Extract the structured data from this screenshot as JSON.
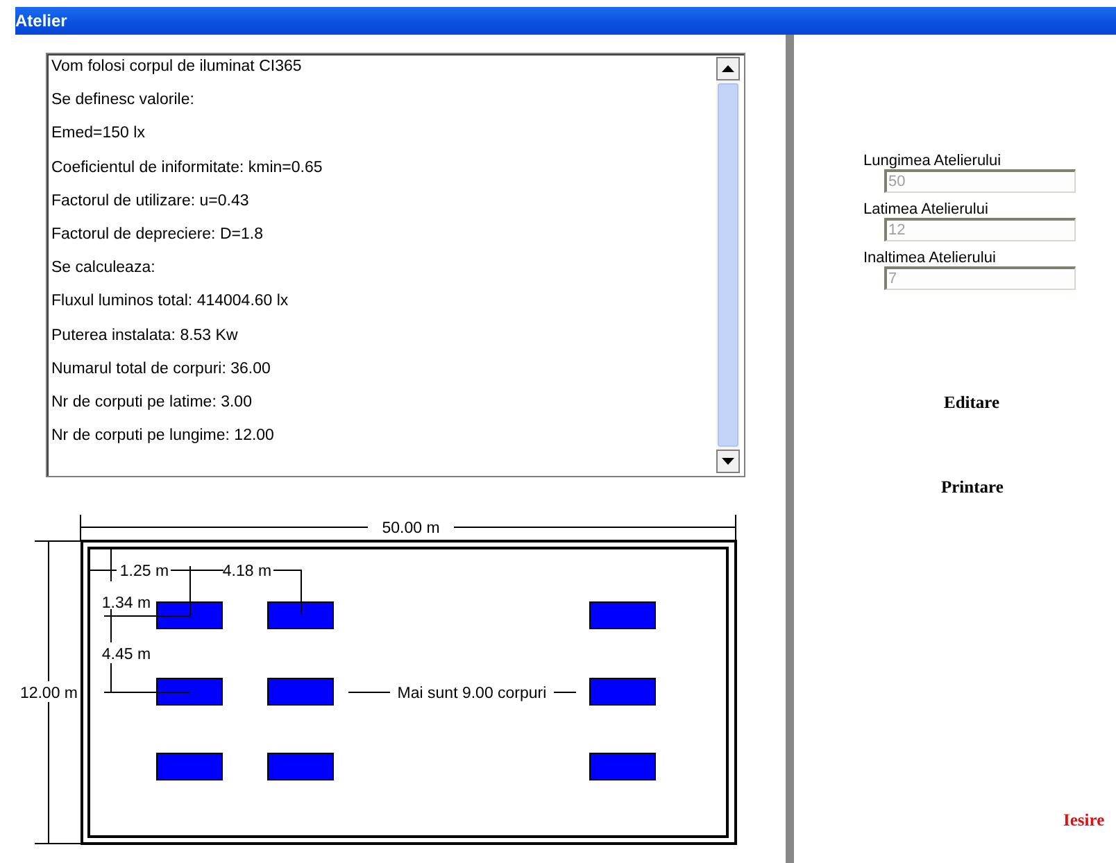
{
  "window": {
    "title": "Atelier"
  },
  "results": [
    "Vom folosi corpul de iluminat CI365",
    "Se definesc  valorile:",
    "Emed=150 lx",
    "Coeficientul de iniformitate: kmin=0.65",
    "Factorul de utilizare: u=0.43",
    "Factorul de depreciere: D=1.8",
    "Se calculeaza:",
    "Fluxul luminos total: 414004.60 lx",
    "Puterea instalata: 8.53 Kw",
    "Numarul total de corpuri: 36.00",
    "Nr de corputi pe latime: 3.00",
    "Nr de corputi pe lungime: 12.00"
  ],
  "plan": {
    "length_label": "50.00 m",
    "width_label": "12.00 m",
    "offset_x_label": "1.25 m",
    "spacing_x_label": "4.18 m",
    "offset_y_label": "1.34 m",
    "spacing_y_label": "4.45 m",
    "remaining_label": "Mai sunt 9.00 corpuri"
  },
  "fields": [
    {
      "label": "Lungimea Atelierului",
      "value": "50",
      "disabled": true
    },
    {
      "label": "Latimea Atelierului",
      "value": "12",
      "disabled": true
    },
    {
      "label": "Inaltimea Atelierului",
      "value": "7",
      "disabled": true
    }
  ],
  "buttons": [
    {
      "label": "Editare",
      "kind": "plain"
    },
    {
      "label": "Printare",
      "kind": "plain"
    },
    {
      "label": "Iesire",
      "kind": "exit"
    }
  ]
}
